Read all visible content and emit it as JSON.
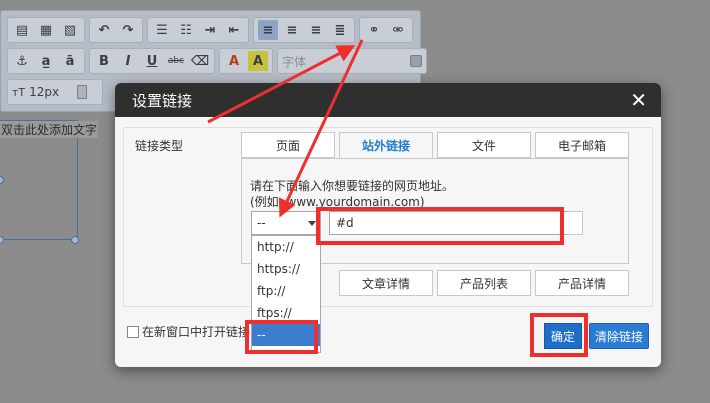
{
  "background": {
    "font_select_label": "字体",
    "font_size_prefix": "тT",
    "font_size_value": "12px",
    "placeholder_text": "双击此处添加文字",
    "toolbar_glyphs": {
      "align_left": "≡",
      "undo": "↶",
      "redo": "↷",
      "bold": "B",
      "italic": "I",
      "underline": "U",
      "strike": "abc",
      "font_color": "A",
      "highlight": "A"
    }
  },
  "dialog": {
    "title": "设置链接",
    "close_glyph": "✕",
    "link_type_label": "链接类型",
    "tabs_row1": [
      "页面",
      "站外链接",
      "文件",
      "电子邮箱"
    ],
    "tabs_row2": [
      "文章详情",
      "产品列表",
      "产品详情"
    ],
    "selected_tab": "站外链接",
    "hint_line1": "请在下面输入你想要链接的网页地址。",
    "hint_line2": "(例如: www.yourdomain.com)",
    "protocol_value": "--",
    "protocol_options": [
      "http://",
      "https://",
      "ftp://",
      "ftps://",
      "--"
    ],
    "url_value": "#d",
    "new_window_label": "在新窗口中打开链接",
    "ok_label": "确定",
    "clear_label": "清除链接"
  },
  "colors": {
    "annotation": "#ee2f2f",
    "primary_button": "#1f6fc7",
    "selected_tab_text": "#1f7fd0",
    "dialog_header": "#2f2f2f"
  }
}
